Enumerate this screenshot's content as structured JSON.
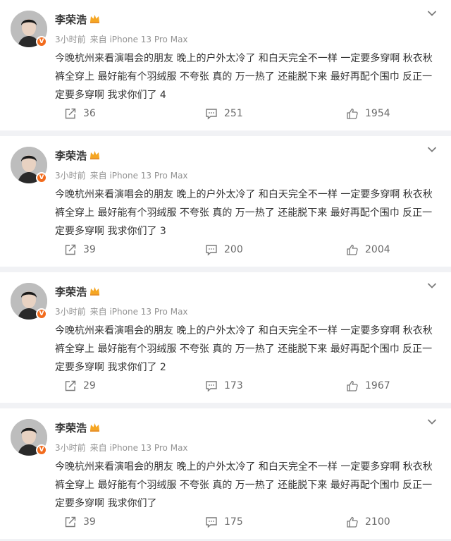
{
  "posts": [
    {
      "author": "李荣浩",
      "time": "3小时前",
      "source": "来自 iPhone 13 Pro Max",
      "text": "今晚杭州来看演唱会的朋友  晚上的户外太冷了 和白天完全不一样 一定要多穿啊 秋衣秋裤全穿上 最好能有个羽绒服 不夸张 真的 万一热了 还能脱下来  最好再配个围巾 反正一定要多穿啊 我求你们了 4",
      "shares": "36",
      "comments": "251",
      "likes": "1954"
    },
    {
      "author": "李荣浩",
      "time": "3小时前",
      "source": "来自 iPhone 13 Pro Max",
      "text": "今晚杭州来看演唱会的朋友  晚上的户外太冷了 和白天完全不一样 一定要多穿啊 秋衣秋裤全穿上 最好能有个羽绒服 不夸张 真的 万一热了 还能脱下来  最好再配个围巾 反正一定要多穿啊 我求你们了 3",
      "shares": "39",
      "comments": "200",
      "likes": "2004"
    },
    {
      "author": "李荣浩",
      "time": "3小时前",
      "source": "来自 iPhone 13 Pro Max",
      "text": "今晚杭州来看演唱会的朋友  晚上的户外太冷了 和白天完全不一样 一定要多穿啊 秋衣秋裤全穿上 最好能有个羽绒服 不夸张 真的 万一热了 还能脱下来  最好再配个围巾 反正一定要多穿啊 我求你们了 2",
      "shares": "29",
      "comments": "173",
      "likes": "1967"
    },
    {
      "author": "李荣浩",
      "time": "3小时前",
      "source": "来自 iPhone 13 Pro Max",
      "text": "今晚杭州来看演唱会的朋友  晚上的户外太冷了 和白天完全不一样 一定要多穿啊 秋衣秋裤全穿上 最好能有个羽绒服 不夸张 真的 万一热了 还能脱下来  最好再配个围巾 反正一定要多穿啊 我求你们了",
      "shares": "39",
      "comments": "175",
      "likes": "2100"
    }
  ],
  "badge": "V",
  "colors": {
    "page_bg": "#f1f2f5",
    "card_bg": "#ffffff",
    "text": "#333333",
    "meta": "#939393",
    "verified_badge": "#f26b1d",
    "crown": "#f5a623"
  },
  "icons": {
    "more": "chevron-down-icon",
    "share": "share-icon",
    "comment": "comment-icon",
    "like": "thumbs-up-icon",
    "crown": "crown-icon",
    "verified": "verified-badge-icon"
  }
}
